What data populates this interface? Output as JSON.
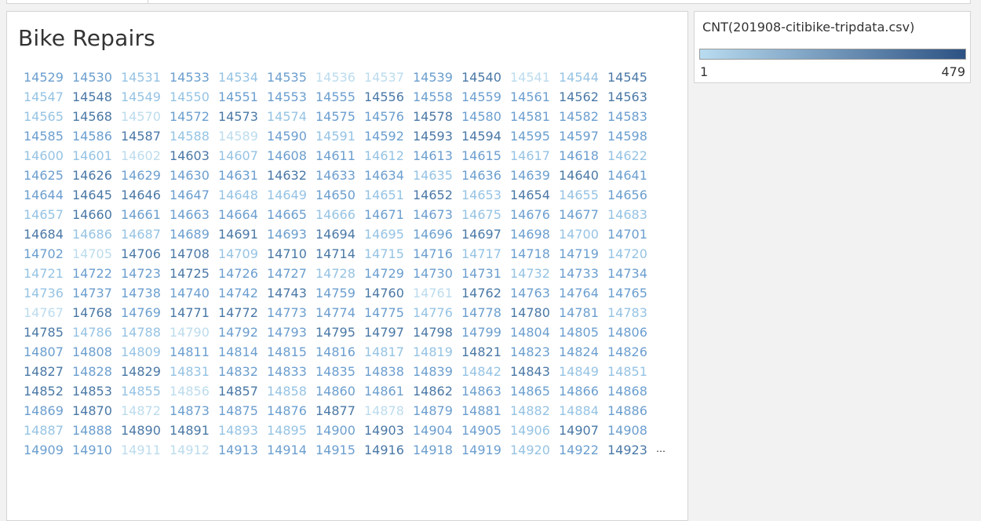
{
  "sheet": {
    "title": "Bike Repairs",
    "overflow_indicator": "…"
  },
  "legend": {
    "title": "CNT(201908-citibike-tripdata.csv)",
    "min": "1",
    "max": "479",
    "color_low": "#b9dcf0",
    "color_high": "#2c5283"
  },
  "rows": [
    [
      [
        "14529",
        2
      ],
      [
        "14530",
        2
      ],
      [
        "14531",
        1
      ],
      [
        "14533",
        2
      ],
      [
        "14534",
        1
      ],
      [
        "14535",
        2
      ],
      [
        "14536",
        0
      ],
      [
        "14537",
        0
      ],
      [
        "14539",
        2
      ],
      [
        "14540",
        3
      ],
      [
        "14541",
        0
      ],
      [
        "14544",
        1
      ],
      [
        "14545",
        3
      ]
    ],
    [
      [
        "14547",
        1
      ],
      [
        "14548",
        3
      ],
      [
        "14549",
        1
      ],
      [
        "14550",
        1
      ],
      [
        "14551",
        2
      ],
      [
        "14553",
        2
      ],
      [
        "14555",
        2
      ],
      [
        "14556",
        3
      ],
      [
        "14558",
        2
      ],
      [
        "14559",
        2
      ],
      [
        "14561",
        2
      ],
      [
        "14562",
        3
      ],
      [
        "14563",
        3
      ]
    ],
    [
      [
        "14565",
        1
      ],
      [
        "14568",
        3
      ],
      [
        "14570",
        0
      ],
      [
        "14572",
        2
      ],
      [
        "14573",
        3
      ],
      [
        "14574",
        1
      ],
      [
        "14575",
        2
      ],
      [
        "14576",
        2
      ],
      [
        "14578",
        3
      ],
      [
        "14580",
        2
      ],
      [
        "14581",
        2
      ],
      [
        "14582",
        2
      ],
      [
        "14583",
        2
      ]
    ],
    [
      [
        "14585",
        2
      ],
      [
        "14586",
        2
      ],
      [
        "14587",
        3
      ],
      [
        "14588",
        1
      ],
      [
        "14589",
        0
      ],
      [
        "14590",
        2
      ],
      [
        "14591",
        1
      ],
      [
        "14592",
        2
      ],
      [
        "14593",
        3
      ],
      [
        "14594",
        3
      ],
      [
        "14595",
        2
      ],
      [
        "14597",
        2
      ],
      [
        "14598",
        2
      ]
    ],
    [
      [
        "14600",
        1
      ],
      [
        "14601",
        1
      ],
      [
        "14602",
        0
      ],
      [
        "14603",
        3
      ],
      [
        "14607",
        1
      ],
      [
        "14608",
        2
      ],
      [
        "14611",
        2
      ],
      [
        "14612",
        1
      ],
      [
        "14613",
        2
      ],
      [
        "14615",
        2
      ],
      [
        "14617",
        1
      ],
      [
        "14618",
        2
      ],
      [
        "14622",
        1
      ]
    ],
    [
      [
        "14625",
        2
      ],
      [
        "14626",
        3
      ],
      [
        "14629",
        2
      ],
      [
        "14630",
        2
      ],
      [
        "14631",
        2
      ],
      [
        "14632",
        3
      ],
      [
        "14633",
        2
      ],
      [
        "14634",
        2
      ],
      [
        "14635",
        1
      ],
      [
        "14636",
        2
      ],
      [
        "14639",
        2
      ],
      [
        "14640",
        3
      ],
      [
        "14641",
        2
      ]
    ],
    [
      [
        "14644",
        2
      ],
      [
        "14645",
        3
      ],
      [
        "14646",
        3
      ],
      [
        "14647",
        2
      ],
      [
        "14648",
        1
      ],
      [
        "14649",
        1
      ],
      [
        "14650",
        2
      ],
      [
        "14651",
        1
      ],
      [
        "14652",
        3
      ],
      [
        "14653",
        1
      ],
      [
        "14654",
        3
      ],
      [
        "14655",
        1
      ],
      [
        "14656",
        2
      ]
    ],
    [
      [
        "14657",
        1
      ],
      [
        "14660",
        3
      ],
      [
        "14661",
        2
      ],
      [
        "14663",
        2
      ],
      [
        "14664",
        2
      ],
      [
        "14665",
        2
      ],
      [
        "14666",
        1
      ],
      [
        "14671",
        2
      ],
      [
        "14673",
        2
      ],
      [
        "14675",
        1
      ],
      [
        "14676",
        2
      ],
      [
        "14677",
        2
      ],
      [
        "14683",
        1
      ]
    ],
    [
      [
        "14684",
        3
      ],
      [
        "14686",
        1
      ],
      [
        "14687",
        1
      ],
      [
        "14689",
        2
      ],
      [
        "14691",
        3
      ],
      [
        "14693",
        2
      ],
      [
        "14694",
        3
      ],
      [
        "14695",
        1
      ],
      [
        "14696",
        2
      ],
      [
        "14697",
        3
      ],
      [
        "14698",
        2
      ],
      [
        "14700",
        1
      ],
      [
        "14701",
        2
      ]
    ],
    [
      [
        "14702",
        2
      ],
      [
        "14705",
        0
      ],
      [
        "14706",
        3
      ],
      [
        "14708",
        3
      ],
      [
        "14709",
        1
      ],
      [
        "14710",
        3
      ],
      [
        "14714",
        3
      ],
      [
        "14715",
        1
      ],
      [
        "14716",
        2
      ],
      [
        "14717",
        1
      ],
      [
        "14718",
        2
      ],
      [
        "14719",
        2
      ],
      [
        "14720",
        1
      ]
    ],
    [
      [
        "14721",
        1
      ],
      [
        "14722",
        2
      ],
      [
        "14723",
        2
      ],
      [
        "14725",
        3
      ],
      [
        "14726",
        2
      ],
      [
        "14727",
        2
      ],
      [
        "14728",
        1
      ],
      [
        "14729",
        2
      ],
      [
        "14730",
        2
      ],
      [
        "14731",
        2
      ],
      [
        "14732",
        1
      ],
      [
        "14733",
        2
      ],
      [
        "14734",
        2
      ]
    ],
    [
      [
        "14736",
        1
      ],
      [
        "14737",
        2
      ],
      [
        "14738",
        2
      ],
      [
        "14740",
        2
      ],
      [
        "14742",
        2
      ],
      [
        "14743",
        3
      ],
      [
        "14759",
        2
      ],
      [
        "14760",
        3
      ],
      [
        "14761",
        0
      ],
      [
        "14762",
        3
      ],
      [
        "14763",
        2
      ],
      [
        "14764",
        2
      ],
      [
        "14765",
        2
      ]
    ],
    [
      [
        "14767",
        0
      ],
      [
        "14768",
        3
      ],
      [
        "14769",
        2
      ],
      [
        "14771",
        3
      ],
      [
        "14772",
        3
      ],
      [
        "14773",
        2
      ],
      [
        "14774",
        2
      ],
      [
        "14775",
        2
      ],
      [
        "14776",
        1
      ],
      [
        "14778",
        2
      ],
      [
        "14780",
        3
      ],
      [
        "14781",
        2
      ],
      [
        "14783",
        1
      ]
    ],
    [
      [
        "14785",
        3
      ],
      [
        "14786",
        1
      ],
      [
        "14788",
        1
      ],
      [
        "14790",
        0
      ],
      [
        "14792",
        2
      ],
      [
        "14793",
        2
      ],
      [
        "14795",
        3
      ],
      [
        "14797",
        3
      ],
      [
        "14798",
        3
      ],
      [
        "14799",
        2
      ],
      [
        "14804",
        2
      ],
      [
        "14805",
        2
      ],
      [
        "14806",
        2
      ]
    ],
    [
      [
        "14807",
        2
      ],
      [
        "14808",
        2
      ],
      [
        "14809",
        1
      ],
      [
        "14811",
        2
      ],
      [
        "14814",
        2
      ],
      [
        "14815",
        2
      ],
      [
        "14816",
        2
      ],
      [
        "14817",
        1
      ],
      [
        "14819",
        1
      ],
      [
        "14821",
        3
      ],
      [
        "14823",
        2
      ],
      [
        "14824",
        2
      ],
      [
        "14826",
        2
      ]
    ],
    [
      [
        "14827",
        3
      ],
      [
        "14828",
        2
      ],
      [
        "14829",
        3
      ],
      [
        "14831",
        1
      ],
      [
        "14832",
        2
      ],
      [
        "14833",
        2
      ],
      [
        "14835",
        2
      ],
      [
        "14838",
        2
      ],
      [
        "14839",
        2
      ],
      [
        "14842",
        1
      ],
      [
        "14843",
        3
      ],
      [
        "14849",
        1
      ],
      [
        "14851",
        1
      ]
    ],
    [
      [
        "14852",
        3
      ],
      [
        "14853",
        3
      ],
      [
        "14855",
        1
      ],
      [
        "14856",
        0
      ],
      [
        "14857",
        3
      ],
      [
        "14858",
        1
      ],
      [
        "14860",
        2
      ],
      [
        "14861",
        2
      ],
      [
        "14862",
        3
      ],
      [
        "14863",
        2
      ],
      [
        "14865",
        2
      ],
      [
        "14866",
        2
      ],
      [
        "14868",
        2
      ]
    ],
    [
      [
        "14869",
        2
      ],
      [
        "14870",
        3
      ],
      [
        "14872",
        0
      ],
      [
        "14873",
        2
      ],
      [
        "14875",
        2
      ],
      [
        "14876",
        2
      ],
      [
        "14877",
        3
      ],
      [
        "14878",
        0
      ],
      [
        "14879",
        2
      ],
      [
        "14881",
        2
      ],
      [
        "14882",
        1
      ],
      [
        "14884",
        1
      ],
      [
        "14886",
        2
      ]
    ],
    [
      [
        "14887",
        1
      ],
      [
        "14888",
        2
      ],
      [
        "14890",
        3
      ],
      [
        "14891",
        3
      ],
      [
        "14893",
        1
      ],
      [
        "14895",
        1
      ],
      [
        "14900",
        2
      ],
      [
        "14903",
        3
      ],
      [
        "14904",
        2
      ],
      [
        "14905",
        2
      ],
      [
        "14906",
        1
      ],
      [
        "14907",
        3
      ],
      [
        "14908",
        2
      ]
    ],
    [
      [
        "14909",
        2
      ],
      [
        "14910",
        2
      ],
      [
        "14911",
        0
      ],
      [
        "14912",
        0
      ],
      [
        "14913",
        2
      ],
      [
        "14914",
        2
      ],
      [
        "14915",
        2
      ],
      [
        "14916",
        3
      ],
      [
        "14918",
        2
      ],
      [
        "14919",
        2
      ],
      [
        "14920",
        1
      ],
      [
        "14922",
        2
      ],
      [
        "14923",
        3
      ]
    ]
  ]
}
